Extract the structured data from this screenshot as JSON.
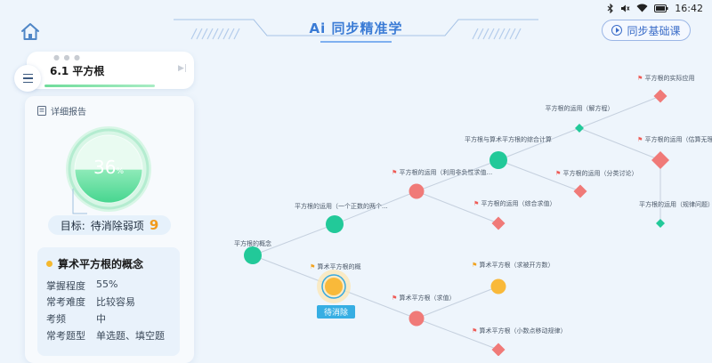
{
  "status": {
    "time": "16:42"
  },
  "header": {
    "title": "Ai 同步精准学",
    "sync_button": "同步基础课"
  },
  "chapter": {
    "title": "6.1 平方根"
  },
  "report": {
    "label": "详细报告",
    "progress_text": "36",
    "progress_unit": "%",
    "progress_value": 36,
    "target_label": "目标:",
    "target_text": "待消除弱项",
    "target_count": "9"
  },
  "concept": {
    "title": "算术平方根的概念",
    "rows": [
      {
        "key": "掌握程度",
        "value": "55%"
      },
      {
        "key": "常考难度",
        "value": "比较容易"
      },
      {
        "key": "考频",
        "value": "中"
      },
      {
        "key": "常考题型",
        "value": "单选题、填空题"
      }
    ]
  },
  "map": {
    "tag_label": "待消除",
    "nodes": [
      {
        "id": "n1",
        "label": "平方根的概念",
        "status": "mastered",
        "shape": "circle"
      },
      {
        "id": "n2",
        "label": "平方根的运用（一个正数的两个...",
        "status": "mastered",
        "shape": "circle"
      },
      {
        "id": "n3",
        "label": "算术平方根的概",
        "status": "current",
        "shape": "circle",
        "flag": true
      },
      {
        "id": "n4",
        "label": "平方根的运用（利用非负性求值...",
        "status": "weak",
        "shape": "circle",
        "flag": true
      },
      {
        "id": "n5",
        "label": "平方根的运用（综合求值）",
        "status": "weak",
        "shape": "diamond",
        "flag": true
      },
      {
        "id": "n6",
        "label": "平方根与算术平方根的综合计算",
        "status": "mastered",
        "shape": "circle"
      },
      {
        "id": "n7",
        "label": "平方根的运用（解方程）",
        "status": "mastered",
        "shape": "diamond"
      },
      {
        "id": "n8",
        "label": "平方根的运用（分类讨论）",
        "status": "weak",
        "shape": "diamond",
        "flag": true
      },
      {
        "id": "n9",
        "label": "平方根的实际应用",
        "status": "weak",
        "shape": "diamond",
        "flag": true
      },
      {
        "id": "n10",
        "label": "平方根的运用（估算无理数的大...",
        "status": "weak",
        "shape": "diamond",
        "flag": true
      },
      {
        "id": "n11",
        "label": "平方根的运用（规律问题）",
        "status": "mastered",
        "shape": "diamond"
      },
      {
        "id": "n12",
        "label": "算术平方根（求值）",
        "status": "weak",
        "shape": "circle",
        "flag": true
      },
      {
        "id": "n13",
        "label": "算术平方根（求被开方数）",
        "status": "current",
        "shape": "circle",
        "flag": true
      },
      {
        "id": "n14",
        "label": "算术平方根（小数点移动规律）",
        "status": "weak",
        "shape": "diamond",
        "flag": true
      }
    ]
  },
  "colors": {
    "mastered": "#22c999",
    "weak": "#f07a78",
    "current": "#f9b93a",
    "accent": "#3a7bd5"
  }
}
